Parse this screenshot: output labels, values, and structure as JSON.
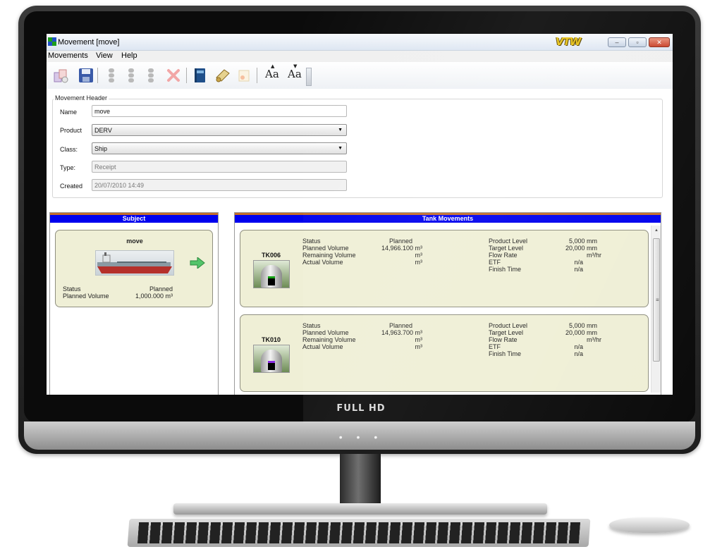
{
  "monitor": {
    "brand": "FULL HD",
    "dots": "• • •"
  },
  "window": {
    "title": "Movement [move]",
    "logo": "VTW",
    "controls": {
      "minimize": "–",
      "maximize": "▫",
      "close": "✕"
    }
  },
  "menu": {
    "items": [
      "Movements",
      "View",
      "Help"
    ]
  },
  "toolbar": {
    "font_increase": "Aa",
    "font_decrease": "Aa",
    "icons": [
      "new-movement-icon",
      "save-icon",
      "traffic-light-icon",
      "traffic-light-icon",
      "traffic-light-icon",
      "delete-icon",
      "book-icon",
      "scroll-icon",
      "certificate-icon",
      "font-increase-icon",
      "font-decrease-icon"
    ]
  },
  "header": {
    "title": "Movement Header",
    "fields": {
      "name": {
        "label": "Name",
        "value": "move"
      },
      "product": {
        "label": "Product",
        "value": "DERV"
      },
      "class": {
        "label": "Class:",
        "value": "Ship"
      },
      "type": {
        "label": "Type:",
        "value": "Receipt"
      },
      "created": {
        "label": "Created",
        "value": "20/07/2010 14:49"
      }
    }
  },
  "subject": {
    "title": "Subject",
    "card": {
      "name": "move",
      "status_label": "Status",
      "status_value": "Planned",
      "volume_label": "Planned Volume",
      "volume_value": "1,000.000 m³"
    }
  },
  "tanks": {
    "title": "Tank Movements",
    "items": [
      {
        "name": "TK006",
        "fill_color": "#000000",
        "level_color": "#14a014",
        "left": [
          {
            "label": "Status",
            "value": "Planned"
          },
          {
            "label": "Planned Volume",
            "value": "14,966.100 m³"
          },
          {
            "label": "Remaining Volume",
            "value": "m³"
          },
          {
            "label": "Actual Volume",
            "value": "m³"
          }
        ],
        "right": [
          {
            "label": "Product Level",
            "value": "5,000 mm"
          },
          {
            "label": "Target Level",
            "value": "20,000 mm"
          },
          {
            "label": "Flow Rate",
            "value": "m³/hr"
          },
          {
            "label": "ETF",
            "value": "n/a"
          },
          {
            "label": "Finish Time",
            "value": "n/a"
          }
        ]
      },
      {
        "name": "TK010",
        "fill_color": "#000000",
        "level_color": "#8a2be2",
        "left": [
          {
            "label": "Status",
            "value": "Planned"
          },
          {
            "label": "Planned Volume",
            "value": "14,963.700 m³"
          },
          {
            "label": "Remaining Volume",
            "value": "m³"
          },
          {
            "label": "Actual Volume",
            "value": "m³"
          }
        ],
        "right": [
          {
            "label": "Product Level",
            "value": "5,000 mm"
          },
          {
            "label": "Target Level",
            "value": "20,000 mm"
          },
          {
            "label": "Flow Rate",
            "value": "m³/hr"
          },
          {
            "label": "ETF",
            "value": "n/a"
          },
          {
            "label": "Finish Time",
            "value": "n/a"
          }
        ]
      }
    ]
  }
}
